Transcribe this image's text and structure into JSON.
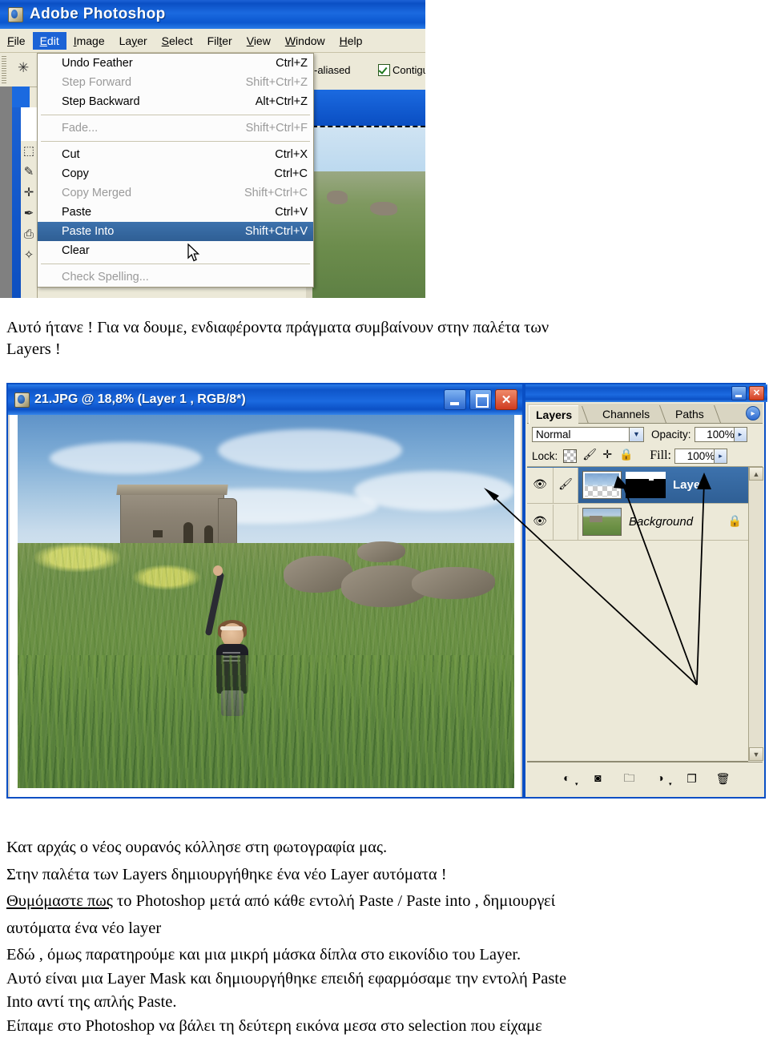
{
  "app": {
    "title": "Adobe Photoshop",
    "icon": "photoshop-app-icon",
    "menubar": [
      "File",
      "Edit",
      "Image",
      "Layer",
      "Select",
      "Filter",
      "View",
      "Window",
      "Help"
    ],
    "active_menu": "Edit"
  },
  "options_bar": {
    "anti_aliased_label": "-aliased",
    "contiguous_label": "Contiguo",
    "contiguous_checked": true
  },
  "edit_menu": {
    "items": [
      {
        "label": "Undo Feather",
        "shortcut": "Ctrl+Z",
        "disabled": false,
        "highlighted": false
      },
      {
        "label": "Step Forward",
        "shortcut": "Shift+Ctrl+Z",
        "disabled": true,
        "highlighted": false
      },
      {
        "label": "Step Backward",
        "shortcut": "Alt+Ctrl+Z",
        "disabled": false,
        "highlighted": false
      },
      {
        "label": "Fade...",
        "shortcut": "Shift+Ctrl+F",
        "disabled": true,
        "highlighted": false
      },
      {
        "label": "Cut",
        "shortcut": "Ctrl+X",
        "disabled": false,
        "highlighted": false
      },
      {
        "label": "Copy",
        "shortcut": "Ctrl+C",
        "disabled": false,
        "highlighted": false
      },
      {
        "label": "Copy Merged",
        "shortcut": "Shift+Ctrl+C",
        "disabled": true,
        "highlighted": false
      },
      {
        "label": "Paste",
        "shortcut": "Ctrl+V",
        "disabled": false,
        "highlighted": false
      },
      {
        "label": "Paste Into",
        "shortcut": "Shift+Ctrl+V",
        "disabled": false,
        "highlighted": true
      },
      {
        "label": "Clear",
        "shortcut": "",
        "disabled": false,
        "highlighted": false
      },
      {
        "label": "Check Spelling...",
        "shortcut": "",
        "disabled": true,
        "highlighted": false
      }
    ]
  },
  "paragraph1": {
    "line1": "Αυτό ήτανε ! Για να δουμε, ενδιαφέροντα πράγματα συμβαίνουν στην παλέτα των",
    "line2": "Layers !"
  },
  "document_window": {
    "title": "21.JPG @ 18,8% (Layer 1 , RGB/8*)",
    "icon": "document-icon",
    "minimize_label": "_",
    "maximize_label": "□",
    "close_label": "✕"
  },
  "layers_palette": {
    "minimize_label": "_",
    "close_label": "✕",
    "tabs": [
      {
        "label": "Layers",
        "active": true
      },
      {
        "label": "Channels",
        "active": false
      },
      {
        "label": "Paths",
        "active": false
      }
    ],
    "menu_arrow": "▸",
    "blend_mode": "Normal",
    "opacity_label": "Opacity:",
    "opacity_value": "100%",
    "lock_label": "Lock:",
    "lock_icons": [
      "transparency-checker-icon",
      "paintbrush-icon",
      "move-icon",
      "padlock-icon"
    ],
    "fill_label": "Fill:",
    "fill_value": "100%",
    "rows": [
      {
        "name": "Laye...",
        "visible": true,
        "selected": true,
        "has_brush_icon": true,
        "has_mask": true,
        "locked": false,
        "thumbnail": "sky-layer-thumbnail",
        "mask_thumbnail": "layer-mask-thumbnail"
      },
      {
        "name": "Background",
        "visible": true,
        "selected": false,
        "has_brush_icon": false,
        "has_mask": false,
        "locked": true,
        "thumbnail": "background-photo-thumbnail",
        "mask_thumbnail": ""
      }
    ],
    "footer_icons": [
      "layer-style-fx-icon",
      "add-layer-mask-icon",
      "new-group-folder-icon",
      "adjustment-layer-icon",
      "new-layer-icon",
      "delete-layer-trash-icon"
    ],
    "scroll_up": "▲",
    "scroll_down": "▼"
  },
  "annotations": {
    "arrow_count": 3,
    "description": "three hand-drawn arrows pointing from the empty palette area to the image canvas, the layer thumbnail, and the layer mask thumbnail"
  },
  "paragraph2": {
    "line1": "Κατ αρχάς ο νέος ουρανός κόλλησε στη φωτογραφία μας.",
    "line2": "Στην παλέτα των Layers δημιουργήθηκε ένα νέο Layer αυτόματα !",
    "line3_underlined": "Θυμόμαστε πως",
    "line3_rest": " το Photoshop μετά από κάθε εντολή Paste / Paste into , δημιουργεί",
    "line4": "αυτόματα ένα νέο layer"
  },
  "paragraph3": {
    "line1": "Εδώ , όμως παρατηρούμε και μια μικρή μάσκα δίπλα στο εικονίδιο του Layer.",
    "line2": "Αυτό είναι μια Layer Mask και δημιουργήθηκε επειδή εφαρμόσαμε την εντολή Paste",
    "line3": "Into αντί της απλής Paste.",
    "line4": "Είπαμε στο Photoshop να βάλει τη δεύτερη εικόνα μεσα στο selection που είχαμε"
  }
}
